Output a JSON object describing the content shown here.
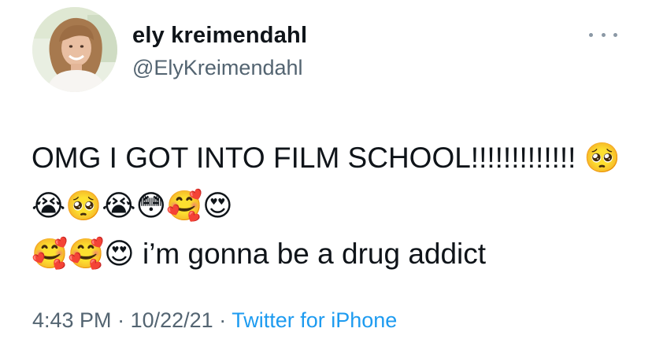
{
  "author": {
    "display_name": "ely kreimendahl",
    "handle": "@ElyKreimendahl"
  },
  "tweet": {
    "text": "OMG I GOT INTO FILM SCHOOL!!!!!!!!!!!!! 🥺😭🥺😭😳🥰😍\n🥰🥰😍 i’m gonna be a drug addict",
    "time": "4:43 PM",
    "separator": "·",
    "date": "10/22/21",
    "source": "Twitter for iPhone"
  },
  "colors": {
    "text": "#0f1419",
    "secondary": "#536471",
    "link": "#1d9bf0"
  },
  "icons": {
    "more": "more-horizontal-icon"
  }
}
